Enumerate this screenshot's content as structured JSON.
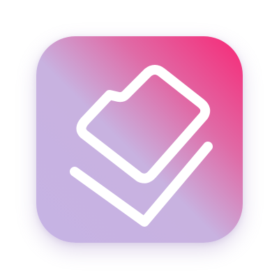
{
  "app_icon": {
    "icon_name": "folders-stack-icon",
    "colors": {
      "gradient_start": "#f72876",
      "gradient_mid": "#e06aa6",
      "gradient_end": "#c6b3e4",
      "glyph": "#ffffff"
    }
  }
}
